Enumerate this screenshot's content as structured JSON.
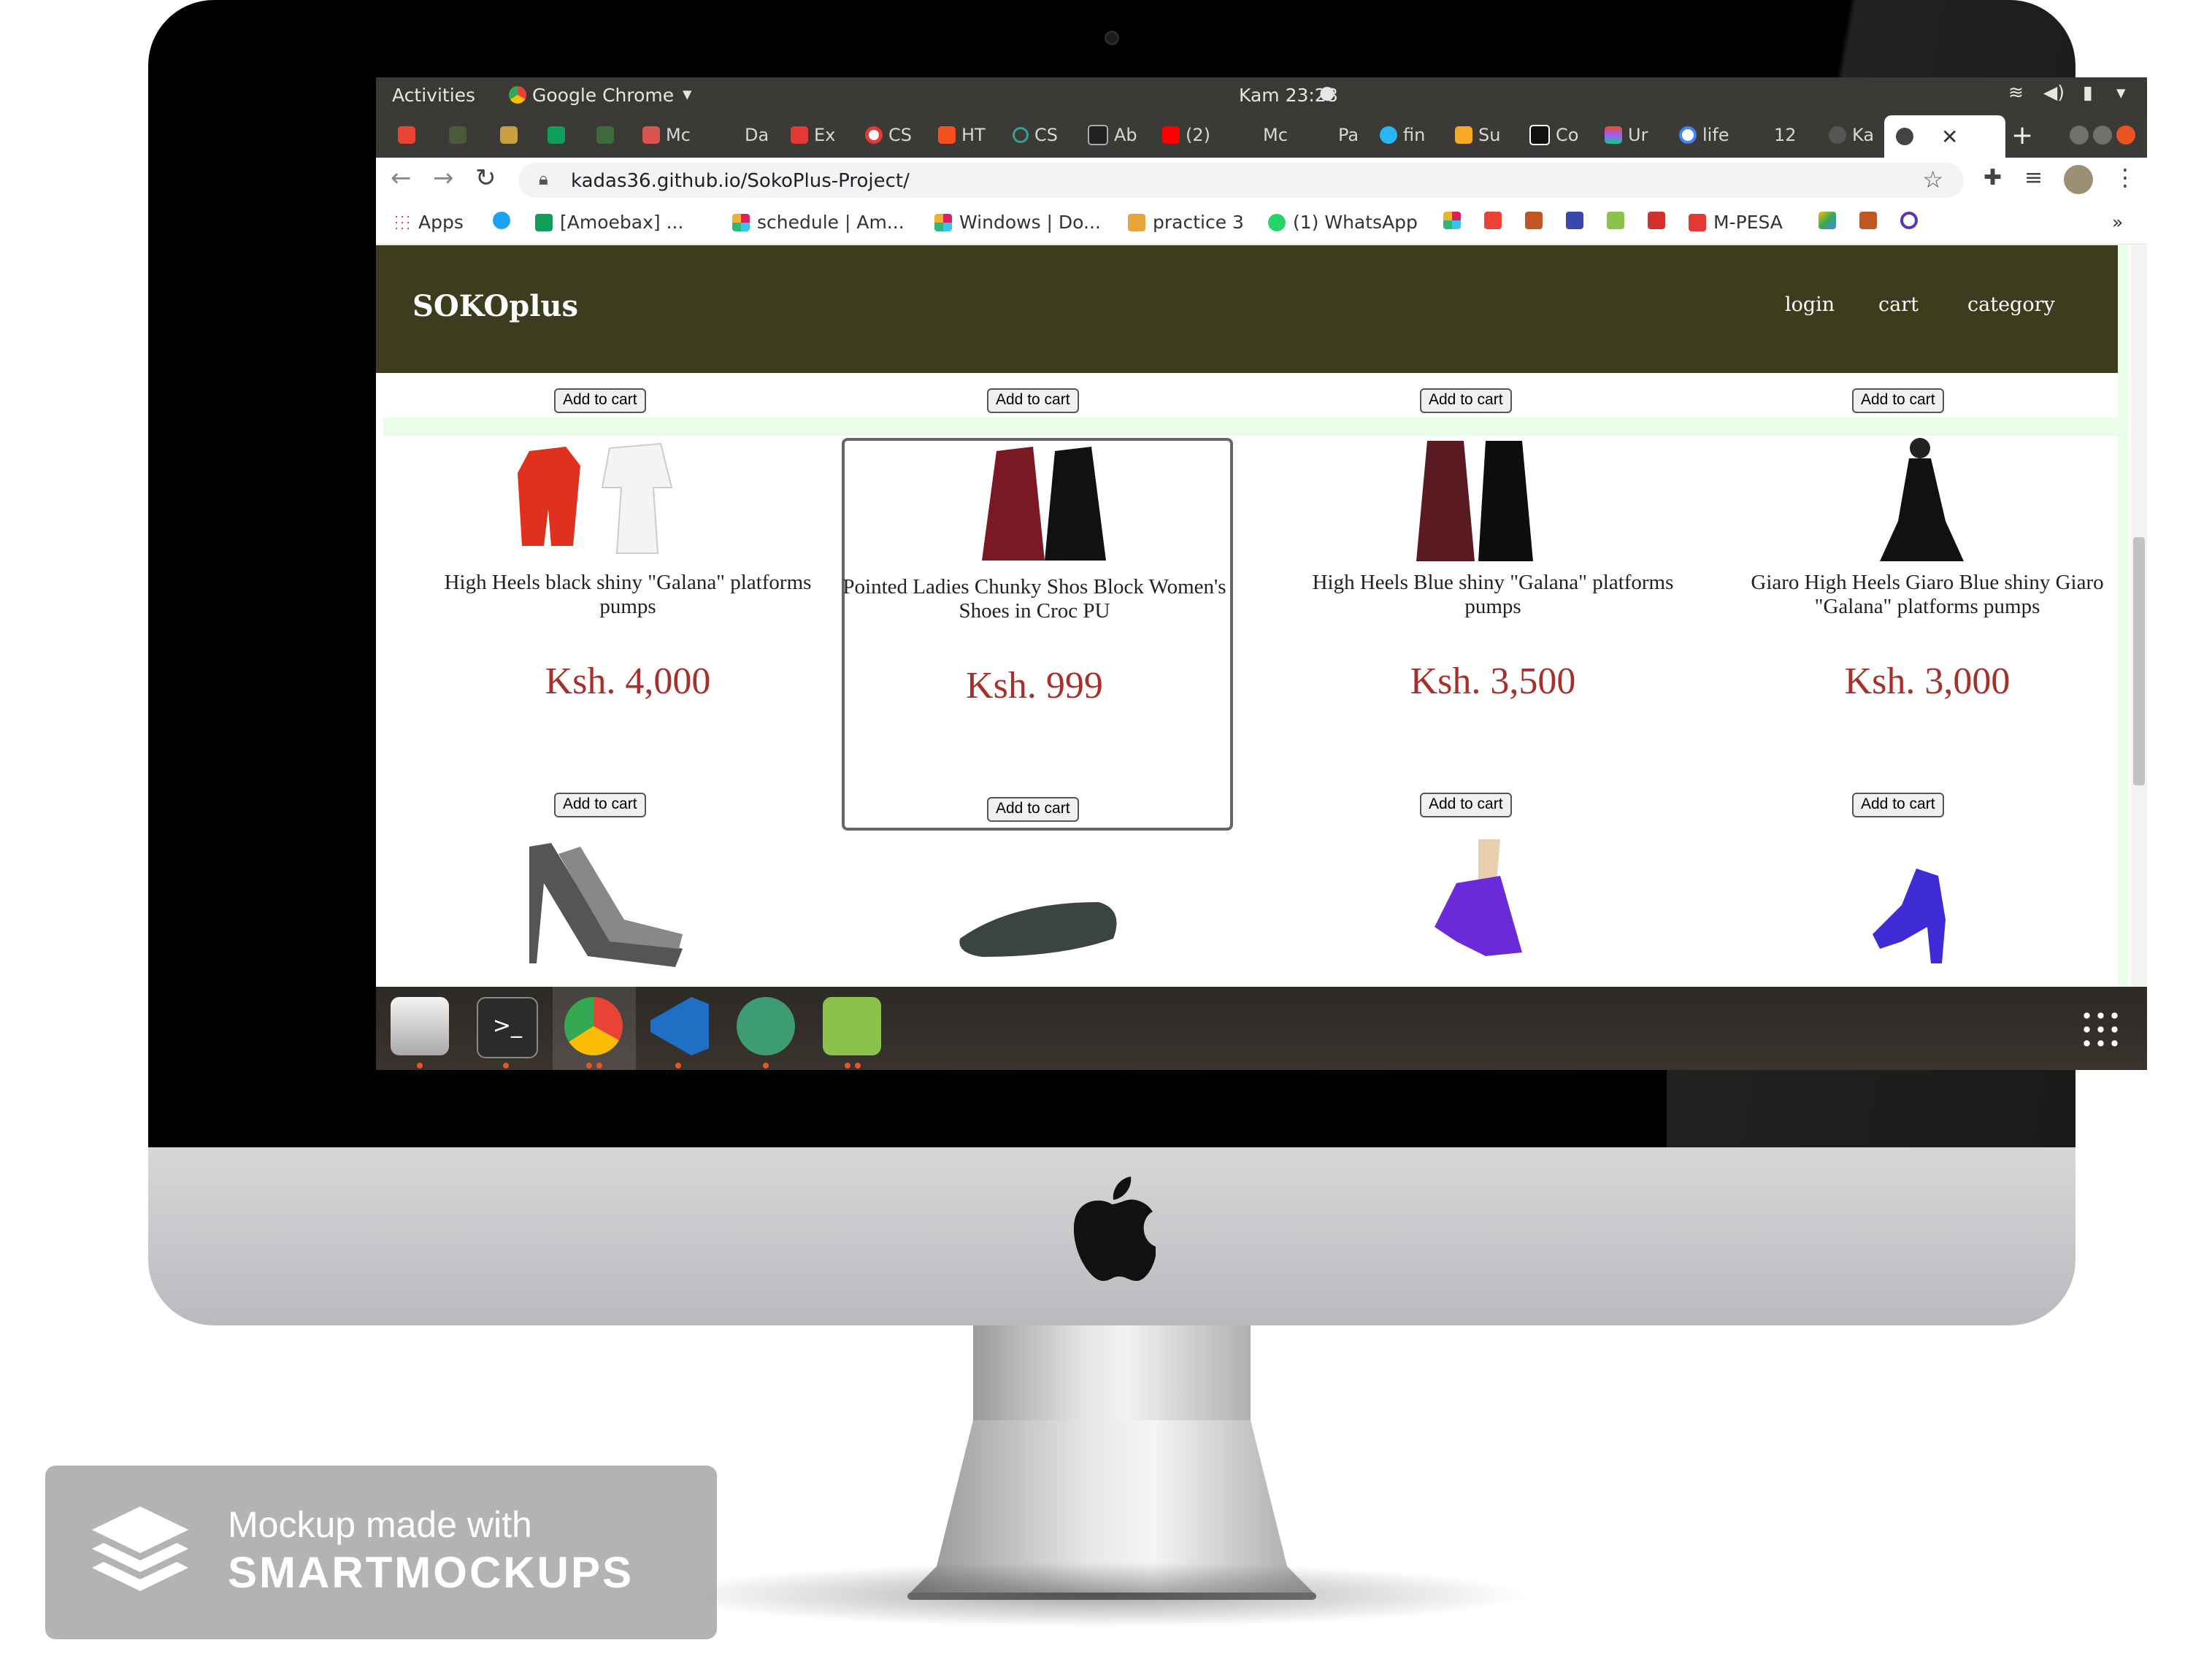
{
  "gnome": {
    "activities": "Activities",
    "app": "Google Chrome",
    "clock": "Kam 23:28"
  },
  "tabs": [
    "Mc",
    "Da",
    "Ex",
    "CS",
    "HT",
    "CS",
    "Ab",
    "(2)",
    "Mc",
    "Pa",
    "fin",
    "Su",
    "Co",
    "Ur",
    "life",
    "12",
    "Ka"
  ],
  "browser": {
    "url": "kadas36.github.io/SokoPlus-Project/"
  },
  "bookmarks": [
    "Apps",
    "[Amoebax] ...",
    "schedule | Am...",
    "Windows | Do...",
    "practice 3",
    "(1) WhatsApp",
    "M-PESA"
  ],
  "site": {
    "brand": "SOKOplus",
    "nav": [
      "login",
      "cart",
      "category"
    ],
    "add_to_cart": "Add to cart",
    "products": [
      {
        "name": "High Heels black shiny \"Galana\" platforms pumps",
        "price": "Ksh. 4,000"
      },
      {
        "name": "Pointed Ladies Chunky Shos Block Women's Shoes in Croc PU",
        "price": "Ksh. 999"
      },
      {
        "name": "High Heels Blue shiny \"Galana\" platforms pumps",
        "price": "Ksh. 3,500"
      },
      {
        "name": "Giaro High Heels Giaro Blue shiny Giaro \"Galana\" platforms pumps",
        "price": "Ksh. 3,000"
      }
    ]
  },
  "badge": {
    "line1": "Mockup made with",
    "line2": "SMARTMOCKUPS"
  },
  "colors": {
    "header": "#3c3c1e",
    "price": "#a8302b",
    "bezel": "#000000"
  }
}
